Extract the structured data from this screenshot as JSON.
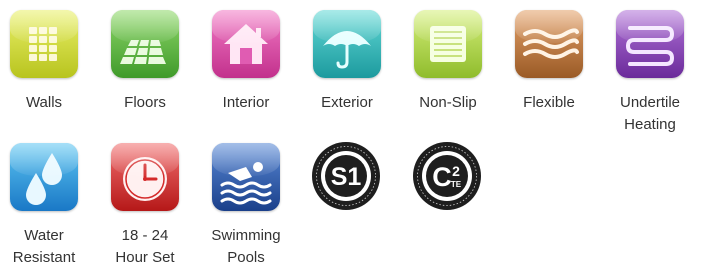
{
  "icons": [
    {
      "id": "walls",
      "icon": "wall-tiles-icon",
      "label_lines": [
        "Walls"
      ],
      "color": "#c9d42c"
    },
    {
      "id": "floors",
      "icon": "floor-tiles-icon",
      "label_lines": [
        "Floors"
      ],
      "color": "#5cb83a"
    },
    {
      "id": "interior",
      "icon": "house-icon",
      "label_lines": [
        "Interior"
      ],
      "color": "#dc4aa8"
    },
    {
      "id": "exterior",
      "icon": "umbrella-icon",
      "label_lines": [
        "Exterior"
      ],
      "color": "#2ab4b6"
    },
    {
      "id": "nonslip",
      "icon": "non-slip-tile-icon",
      "label_lines": [
        "Non-Slip"
      ],
      "color": "#acd23e"
    },
    {
      "id": "flexible",
      "icon": "flexible-waves-icon",
      "label_lines": [
        "Flexible"
      ],
      "color": "#b87640"
    },
    {
      "id": "undertile",
      "icon": "heating-coil-icon",
      "label_lines": [
        "Undertile",
        "Heating"
      ],
      "color": "#8a44b8"
    },
    {
      "id": "water",
      "icon": "water-drops-icon",
      "label_lines": [
        "Water",
        "Resistant"
      ],
      "color": "#2e98dc"
    },
    {
      "id": "hourset",
      "icon": "clock-icon",
      "label_lines": [
        "18 - 24",
        "Hour Set"
      ],
      "color": "#d42a2a"
    },
    {
      "id": "pools",
      "icon": "swimmer-icon",
      "label_lines": [
        "Swimming",
        "Pools"
      ],
      "color": "#2a5ab4"
    }
  ],
  "badges": [
    {
      "id": "s1",
      "icon": "s1-classification-badge-icon",
      "text": "S1"
    },
    {
      "id": "c2te",
      "icon": "c2te-classification-badge-icon",
      "text_main": "C",
      "text_sup": "2",
      "text_sub": "TE"
    }
  ]
}
